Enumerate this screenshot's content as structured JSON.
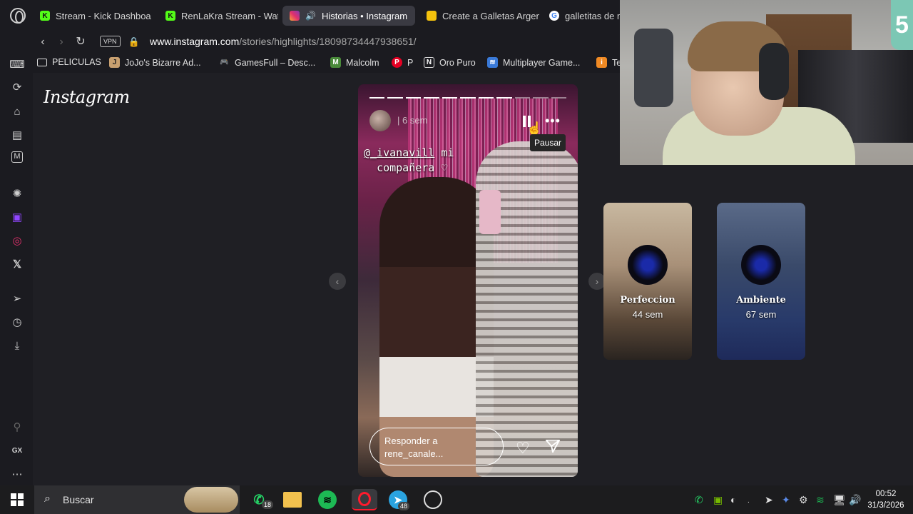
{
  "tabs": [
    {
      "label": "Stream - Kick Dashboa",
      "icon": "kick-icon",
      "color": "#53fc18"
    },
    {
      "label": "RenLaKra Stream - Wat",
      "icon": "kick-icon",
      "color": "#53fc18"
    },
    {
      "label": "Historias • Instagram",
      "icon": "instagram-icon",
      "active": true
    },
    {
      "label": "Create a Galletas Argen",
      "icon": "grid-icon"
    },
    {
      "label": "galletitas de m",
      "icon": "google-icon"
    }
  ],
  "nav": {
    "vpn_label": "VPN",
    "url_host": "www.instagram.com",
    "url_path": "/stories/highlights/18098734447938651/"
  },
  "bookmarks": [
    {
      "label": "PELICULAS",
      "icon": "folder-icon"
    },
    {
      "label": "JoJo's Bizarre Ad...",
      "icon": "jojo-icon"
    },
    {
      "label": "GamesFull – Desc...",
      "icon": "gamepad-icon"
    },
    {
      "label": "Malcolm",
      "icon": "malcolm-icon"
    },
    {
      "label": "P",
      "icon": "pinterest-icon"
    },
    {
      "label": "Oro Puro",
      "icon": "n-icon"
    },
    {
      "label": "Multiplayer Game...",
      "icon": "multiplayer-icon"
    },
    {
      "label": "Te",
      "icon": "te-icon"
    }
  ],
  "page": {
    "logo": "Instagram",
    "story": {
      "time": "6 sem",
      "tooltip": "Pausar",
      "sticker_handle": "@_ivanavill",
      "sticker_text_1": "mi",
      "sticker_text_2": "compañera ♡",
      "reply_placeholder": "Responder a rene_canale...",
      "progress_total": 11,
      "progress_done": 8
    },
    "highlights": [
      {
        "title": "Perfeccion",
        "age": "44 sem"
      },
      {
        "title": "Ambiente",
        "age": "67 sem"
      }
    ]
  },
  "webcam": {
    "badge": "5"
  },
  "taskbar": {
    "search_placeholder": "Buscar",
    "whatsapp_badge": "18",
    "telegram_badge": "48",
    "time": "00:52",
    "date": "31/3/2026"
  },
  "colors": {
    "accent_kick": "#53fc18",
    "opera_red": "#ff1b2d",
    "instagram_pink": "#e1306c"
  }
}
